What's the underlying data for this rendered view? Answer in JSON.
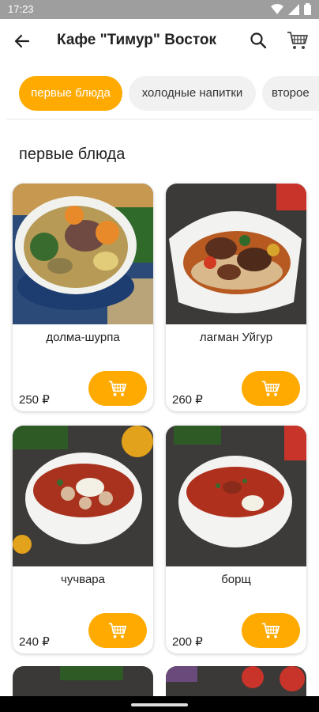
{
  "status_bar": {
    "time": "17:23"
  },
  "app_bar": {
    "title": "Кафе \"Тимур\"  Восток"
  },
  "categories": [
    {
      "label": "первые блюда",
      "active": true
    },
    {
      "label": "холодные напитки",
      "active": false
    },
    {
      "label": "второе",
      "active": false
    }
  ],
  "section": {
    "title": "первые блюда"
  },
  "products": [
    {
      "name": "долма-шурпа",
      "price": "250 ₽"
    },
    {
      "name": "лагман Уйгур",
      "price": "260 ₽"
    },
    {
      "name": "чучвара",
      "price": "240 ₽"
    },
    {
      "name": "борщ",
      "price": "200 ₽"
    }
  ],
  "colors": {
    "accent": "#ffaa00",
    "status_bar": "#9e9e9e"
  },
  "icons": [
    "back-arrow-icon",
    "search-icon",
    "cart-icon",
    "wifi-icon",
    "signal-icon",
    "battery-icon"
  ]
}
